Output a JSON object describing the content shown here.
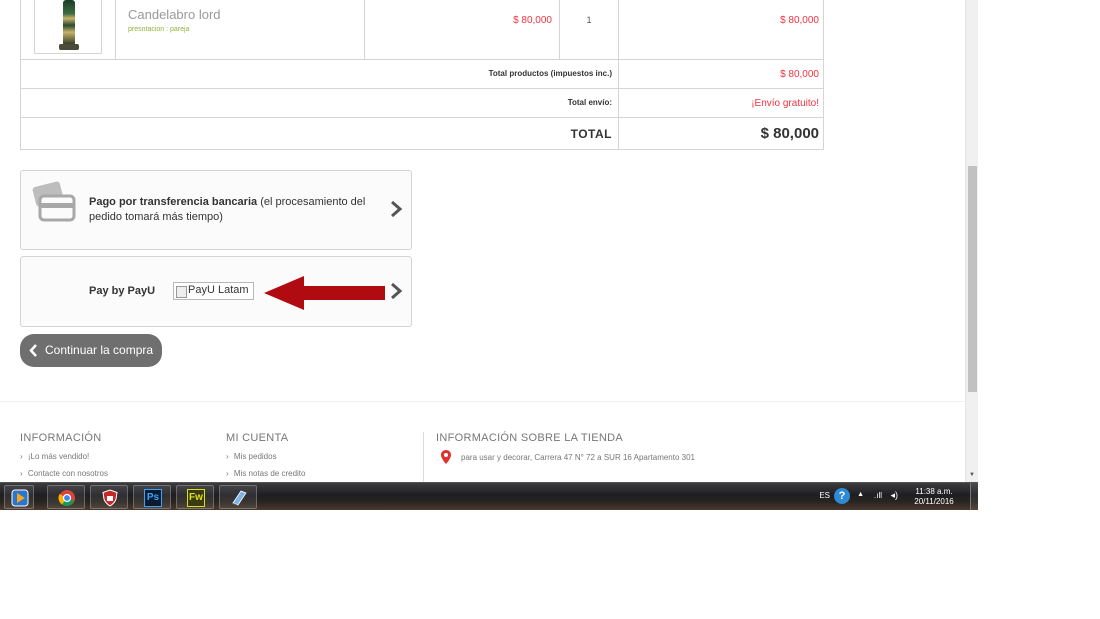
{
  "cart": {
    "product": {
      "name": "Candelabro lord",
      "attributes": "presntacion : pareja",
      "unit_price": "$ 80,000",
      "quantity": "1",
      "subtotal": "$ 80,000"
    },
    "totals": {
      "products_label": "Total productos (impuestos inc.)",
      "products_value": "$ 80,000",
      "shipping_label": "Total envío:",
      "shipping_value": "¡Envío gratuito!",
      "total_label": "TOTAL",
      "total_value": "$ 80,000"
    }
  },
  "payment": {
    "bank": {
      "title": "Pago por transferencia bancaria",
      "note": "(el procesamiento del pedido tomará más tiempo)"
    },
    "payu": {
      "label": "Pay by PayU",
      "image_alt": "PayU Latam"
    }
  },
  "continue_label": "Continuar la compra",
  "footer": {
    "info": {
      "title": "INFORMACIÓN",
      "items": [
        "¡Lo más vendido!",
        "Contacte con nosotros"
      ]
    },
    "account": {
      "title": "MI CUENTA",
      "items": [
        "Mis pedidos",
        "Mis notas de credito"
      ]
    },
    "store": {
      "title": "INFORMACIÓN SOBRE LA TIENDA",
      "address": "para usar y decorar, Carrera 47 N° 72 a SUR 16 Apartamento 301"
    }
  },
  "taskbar": {
    "apps": [
      "media-player",
      "chrome",
      "shield",
      "photoshop",
      "fireworks",
      "notes"
    ],
    "photoshop_label": "Ps",
    "fireworks_label": "Fw",
    "language": "ES",
    "time": "11:38 a.m.",
    "date": "20/11/2016"
  },
  "colors": {
    "price_red": "#f13340",
    "arrow_red": "#b10b12",
    "attr_green": "#8cb43c",
    "button_gray": "#6f6f6f"
  }
}
